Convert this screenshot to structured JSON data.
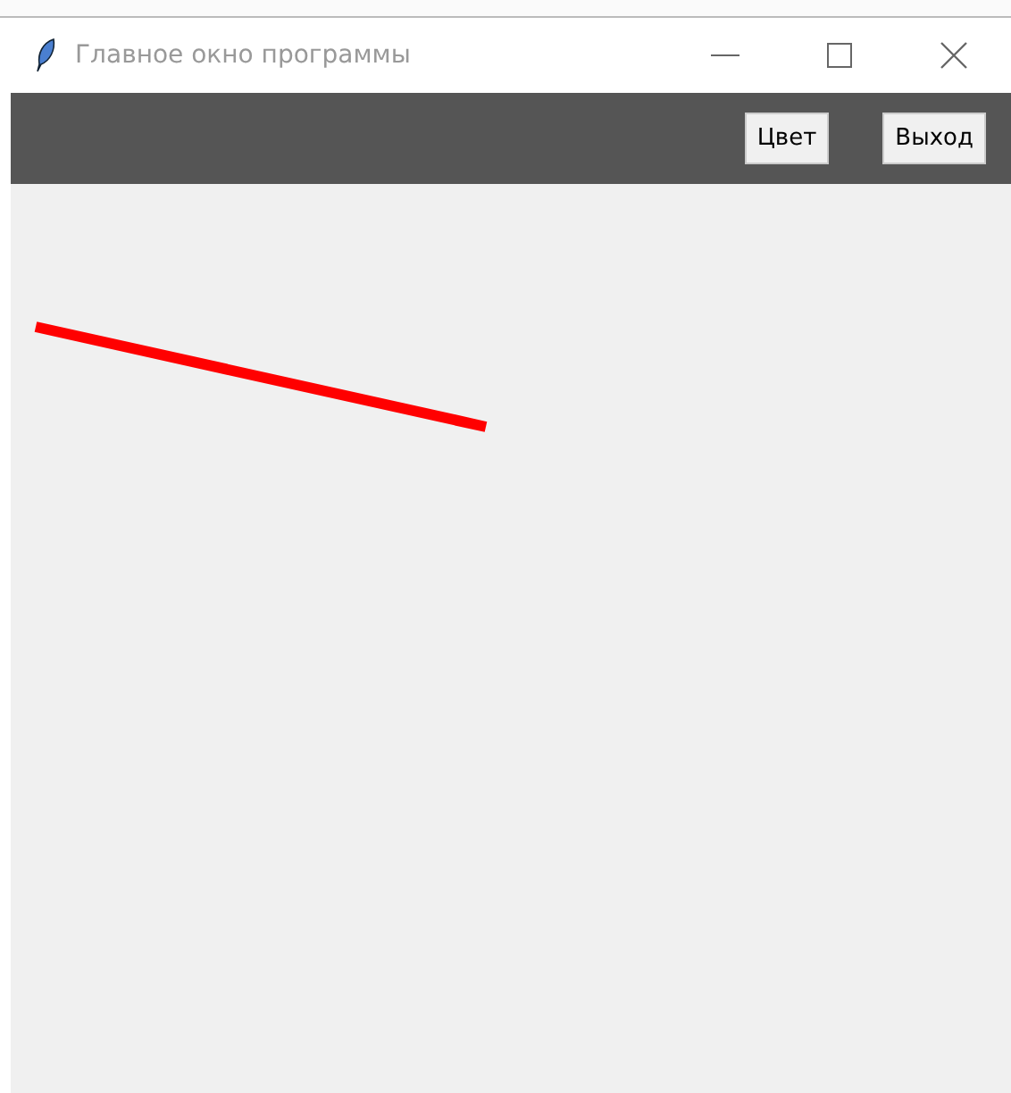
{
  "window": {
    "title": "Главное окно программы"
  },
  "toolbar": {
    "buttons": [
      {
        "label": "Цвет"
      },
      {
        "label": "Выход"
      }
    ]
  }
}
